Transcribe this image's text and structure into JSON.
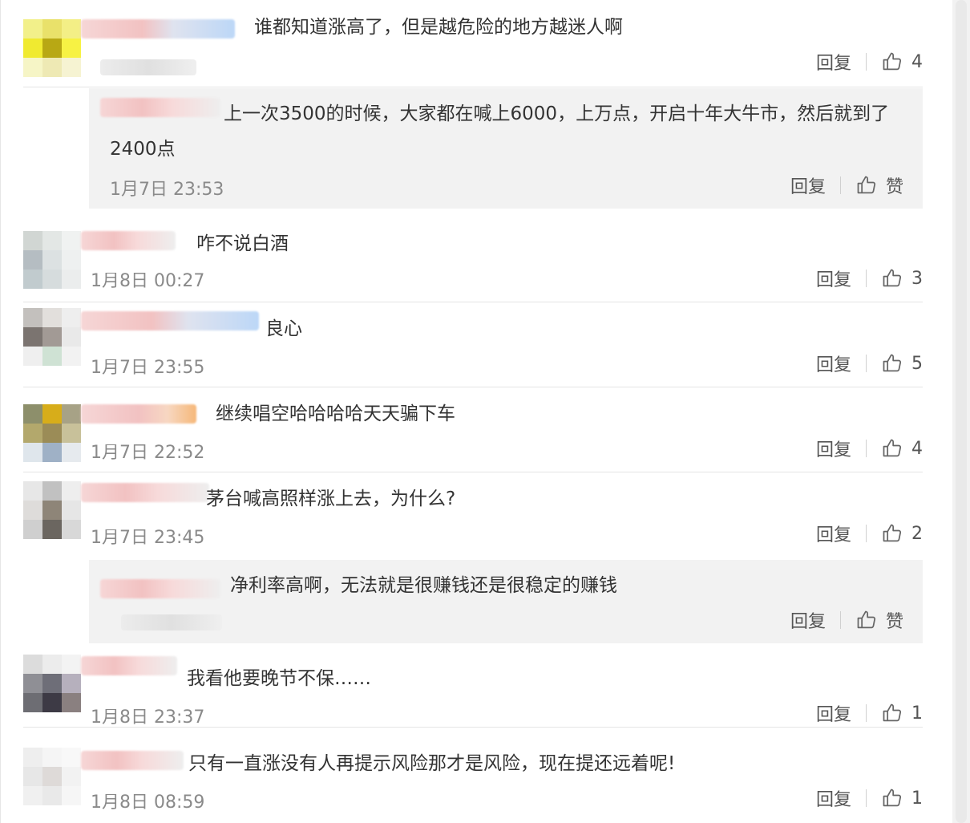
{
  "labels": {
    "reply": "回复"
  },
  "comments": [
    {
      "text": "谁都知道涨高了，但是越危险的地方越迷人啊",
      "time": "",
      "likes": "4"
    },
    {
      "text": "上一次3500的时候，大家都在喊上6000，上万点，开启十年大牛市，然后就到了2400点",
      "time": "1月7日 23:53",
      "likes": "赞"
    },
    {
      "text": "咋不说白酒",
      "time": "1月8日 00:27",
      "likes": "3"
    },
    {
      "text": "良心",
      "time": "1月7日 23:55",
      "likes": "5"
    },
    {
      "text": "继续唱空哈哈哈哈天天骗下车",
      "time": "1月7日 22:52",
      "likes": "4"
    },
    {
      "text": "茅台喊高照样涨上去，为什么?",
      "time": "1月7日 23:45",
      "likes": "2"
    },
    {
      "text": "净利率高啊，无法就是很赚钱还是很稳定的赚钱",
      "time": "",
      "likes": "赞"
    },
    {
      "text": "我看他要晚节不保……",
      "time": "1月8日 23:37",
      "likes": "1"
    },
    {
      "text": "只有一直涨没有人再提示风险那才是风险，现在提还远着呢!",
      "time": "1月8日 08:59",
      "likes": "1"
    }
  ],
  "colors": {
    "panel_bg": "#ffffff",
    "reply_bg": "#f2f2f2",
    "text": "#333333",
    "meta": "#8a8a8a"
  },
  "icons": {
    "like": "thumbs-up-icon"
  }
}
